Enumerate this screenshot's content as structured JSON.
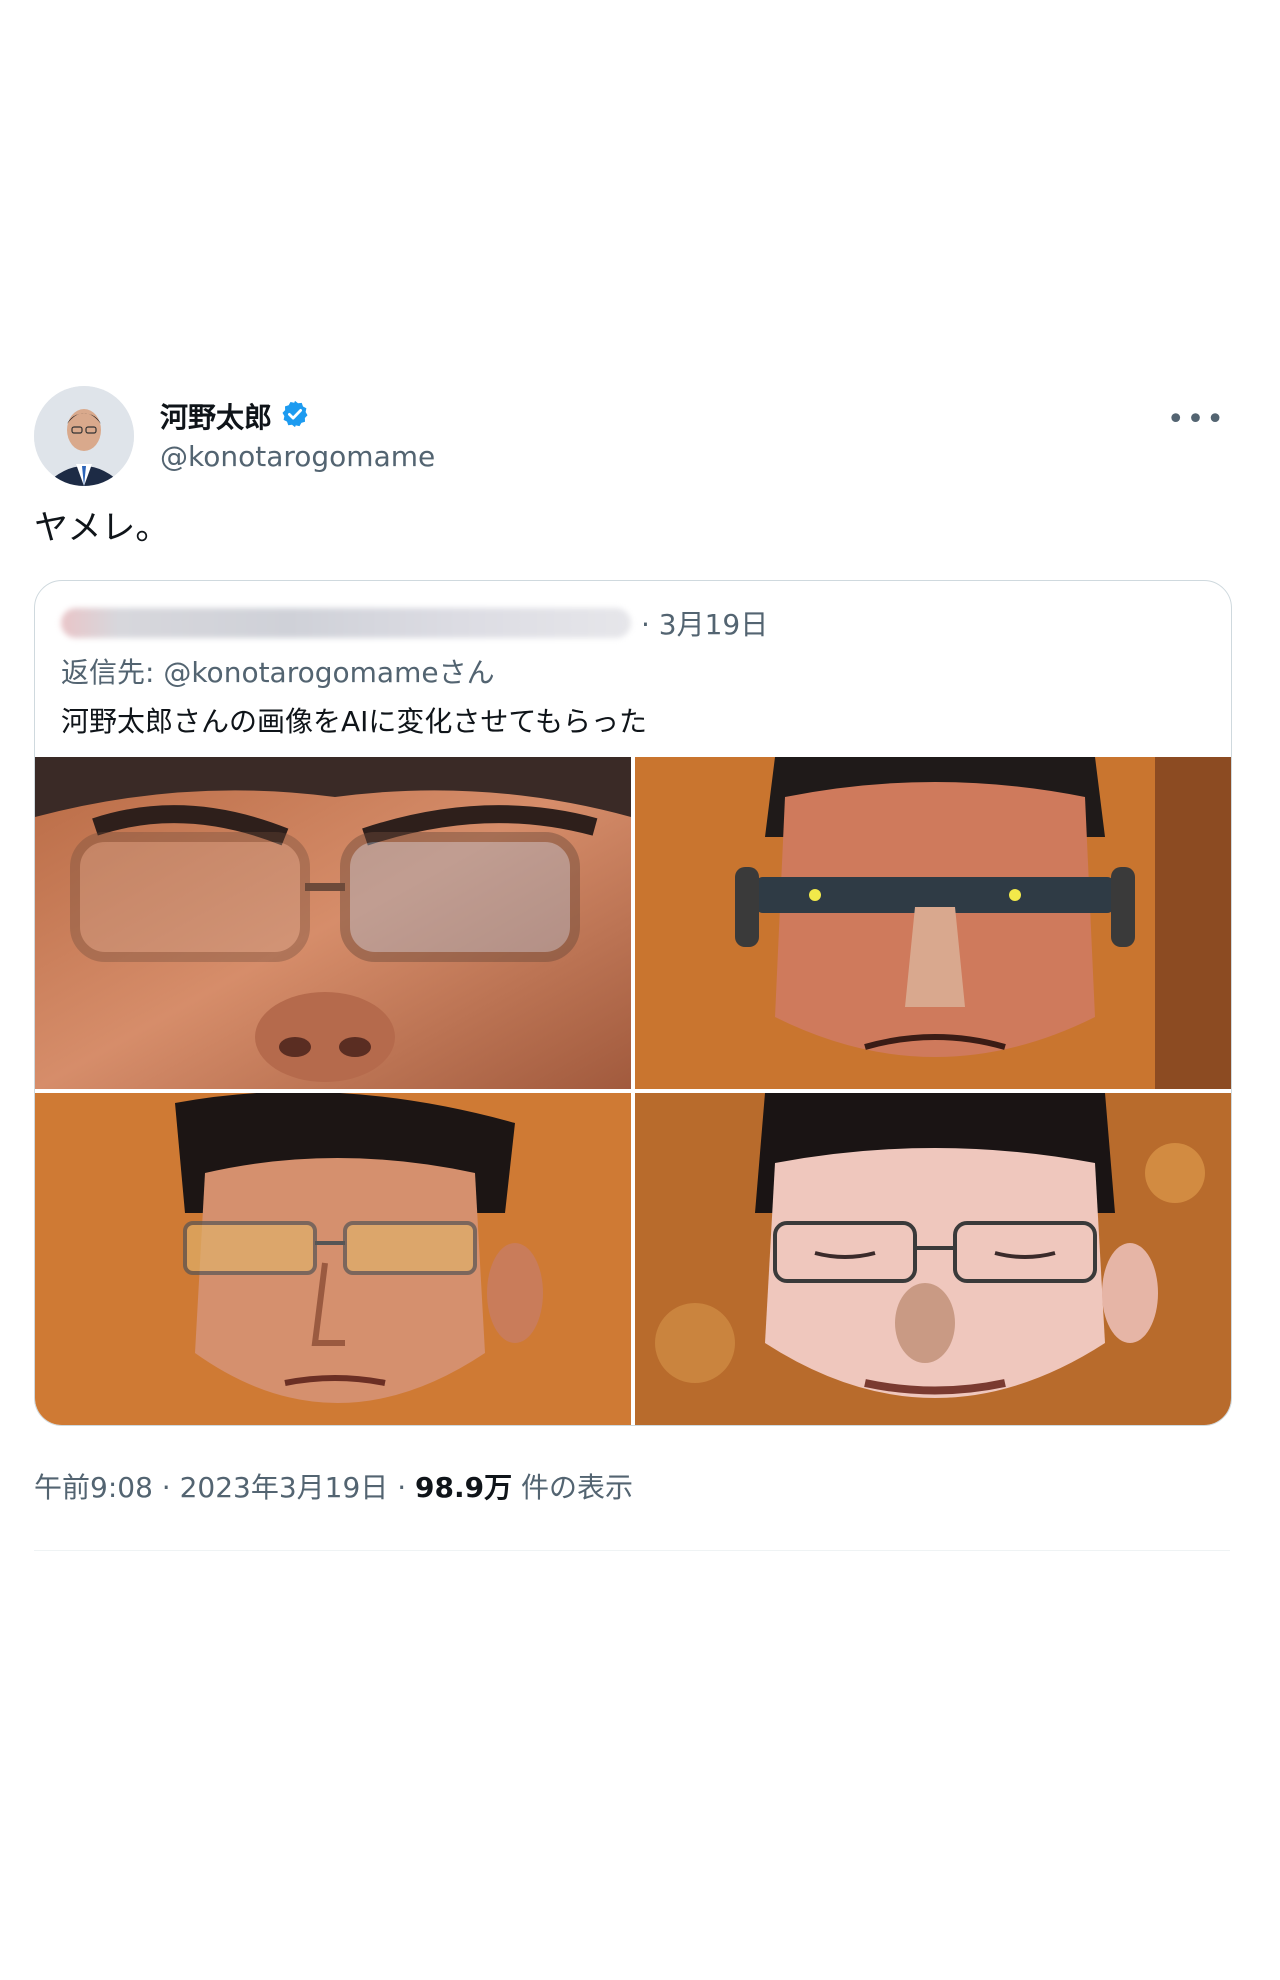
{
  "tweet": {
    "display_name": "河野太郎",
    "handle": "@konotarogomame",
    "text": "ヤメレ。",
    "more_icon": "ellipsis-icon",
    "verified_color": "#1d9bf0"
  },
  "quote": {
    "date": "· 3月19日",
    "reply_prefix": "返信先: ",
    "reply_handle": "@konotarogomame",
    "reply_suffix": "さん",
    "text": "河野太郎さんの画像をAIに変化させてもらった"
  },
  "footer": {
    "time": "午前9:08",
    "sep1": " · ",
    "date": "2023年3月19日",
    "sep2": " · ",
    "views_count": "98.9万",
    "views_label": " 件の表示"
  }
}
